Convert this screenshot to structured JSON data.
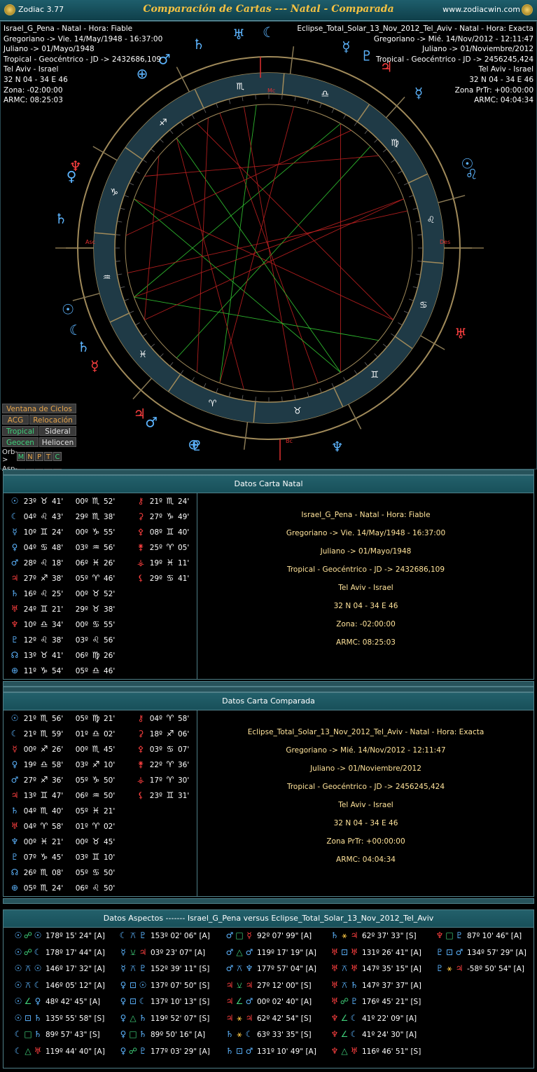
{
  "app": {
    "name": "Zodiac 3.77",
    "title": "Comparación de Cartas --- Natal - Comparada",
    "url": "www.zodiacwin.com"
  },
  "natal_header": [
    "Israel_G_Pena - Natal - Hora: Fiable",
    "Gregoriano -> Vie. 14/May/1948 - 16:37:00",
    "Juliano -> 01/Mayo/1948",
    "Tropical - Geocéntrico - JD -> 2432686,109",
    "Tel Aviv - Israel",
    "32 N 04 - 34 E 46",
    "Zona: -02:00:00",
    "ARMC: 08:25:03"
  ],
  "comp_header": [
    "Eclipse_Total_Solar_13_Nov_2012_Tel_Aviv - Natal - Hora: Exacta",
    "Gregoriano -> Mié. 14/Nov/2012 - 12:11:47",
    "Juliano -> 01/Noviembre/2012",
    "Tropical - Geocéntrico - JD -> 2456245,424",
    "Tel Aviv - Israel",
    "32 N 04 - 34 E 46",
    "Zona PrTr: +00:00:00",
    "ARMC: 04:04:34"
  ],
  "chart_labels": {
    "mc": "Mc",
    "asc": "Asc",
    "des": "Des",
    "bc": "Bc"
  },
  "buttons": {
    "ciclos": "Ventana de Ciclos",
    "acg": "ACG",
    "relocacion": "Relocación",
    "tropical": "Tropical",
    "sideral": "Sideral",
    "geocen": "Geocen",
    "heliocen": "Heliocen",
    "orb": "Orb->",
    "asp": "Asp->",
    "letters": [
      "M",
      "N",
      "P",
      "T",
      "C"
    ]
  },
  "natal_panel": {
    "title": "Datos Carta Natal",
    "rows": [
      {
        "p": "☉",
        "c": "#5db5ff",
        "d": "23º",
        "s": "♉",
        "m": "41'"
      },
      {
        "p": "☾",
        "c": "#5db5ff",
        "d": "04º",
        "s": "♌",
        "m": "43'"
      },
      {
        "p": "☿",
        "c": "#5db5ff",
        "d": "10º",
        "s": "♊",
        "m": "24'"
      },
      {
        "p": "♀",
        "c": "#5db5ff",
        "d": "04º",
        "s": "♋",
        "m": "48'"
      },
      {
        "p": "♂",
        "c": "#5db5ff",
        "d": "28º",
        "s": "♌",
        "m": "18'"
      },
      {
        "p": "♃",
        "c": "#ff4040",
        "d": "27º",
        "s": "♐",
        "m": "38'"
      },
      {
        "p": "♄",
        "c": "#5db5ff",
        "d": "16º",
        "s": "♌",
        "m": "25'"
      },
      {
        "p": "♅",
        "c": "#ff4040",
        "d": "24º",
        "s": "♊",
        "m": "21'"
      },
      {
        "p": "♆",
        "c": "#ff4040",
        "d": "10º",
        "s": "♎",
        "m": "34'"
      },
      {
        "p": "♇",
        "c": "#5db5ff",
        "d": "12º",
        "s": "♌",
        "m": "38'"
      },
      {
        "p": "☊",
        "c": "#5db5ff",
        "d": "13º",
        "s": "♉",
        "m": "41'"
      },
      {
        "p": "⊕",
        "c": "#5db5ff",
        "d": "11º",
        "s": "♑",
        "m": "54'"
      }
    ],
    "col2": [
      {
        "d": "00º",
        "s": "♏",
        "m": "52'"
      },
      {
        "d": "29º",
        "s": "♏",
        "m": "38'"
      },
      {
        "d": "00º",
        "s": "♑",
        "m": "55'"
      },
      {
        "d": "03º",
        "s": "♒",
        "m": "56'"
      },
      {
        "d": "06º",
        "s": "♓",
        "m": "26'"
      },
      {
        "d": "05º",
        "s": "♈",
        "m": "46'"
      },
      {
        "d": "00º",
        "s": "♉",
        "m": "52'"
      },
      {
        "d": "29º",
        "s": "♉",
        "m": "38'"
      },
      {
        "d": "00º",
        "s": "♋",
        "m": "55'"
      },
      {
        "d": "03º",
        "s": "♌",
        "m": "56'"
      },
      {
        "d": "06º",
        "s": "♍",
        "m": "26'"
      },
      {
        "d": "05º",
        "s": "♎",
        "m": "46'"
      }
    ],
    "col3": [
      {
        "p": "⚷",
        "c": "#ff4040",
        "d": "21º",
        "s": "♏",
        "m": "24'"
      },
      {
        "p": "⚳",
        "c": "#ff4040",
        "d": "27º",
        "s": "♑",
        "m": "49'"
      },
      {
        "p": "⚴",
        "c": "#ff4040",
        "d": "08º",
        "s": "♊",
        "m": "40'"
      },
      {
        "p": "⚵",
        "c": "#ff4040",
        "d": "25º",
        "s": "♈",
        "m": "05'"
      },
      {
        "p": "⚶",
        "c": "#ff4040",
        "d": "19º",
        "s": "♓",
        "m": "11'"
      },
      {
        "p": "⚸",
        "c": "#ff4040",
        "d": "29º",
        "s": "♋",
        "m": "41'"
      }
    ],
    "info": [
      "Israel_G_Pena - Natal - Hora: Fiable",
      "Gregoriano -> Vie. 14/May/1948 - 16:37:00",
      "Juliano -> 01/Mayo/1948",
      "Tropical - Geocéntrico - JD -> 2432686,109",
      "Tel Aviv - Israel",
      "32 N 04 - 34 E 46",
      "Zona: -02:00:00",
      "ARMC: 08:25:03"
    ]
  },
  "comp_panel": {
    "title": "Datos Carta Comparada",
    "rows": [
      {
        "p": "☉",
        "c": "#5db5ff",
        "d": "21º",
        "s": "♏",
        "m": "56'"
      },
      {
        "p": "☾",
        "c": "#5db5ff",
        "d": "21º",
        "s": "♏",
        "m": "59'"
      },
      {
        "p": "☿",
        "c": "#ff4040",
        "d": "00º",
        "s": "♐",
        "m": "26'"
      },
      {
        "p": "♀",
        "c": "#5db5ff",
        "d": "19º",
        "s": "♎",
        "m": "58'"
      },
      {
        "p": "♂",
        "c": "#5db5ff",
        "d": "27º",
        "s": "♐",
        "m": "36'"
      },
      {
        "p": "♃",
        "c": "#ff4040",
        "d": "13º",
        "s": "♊",
        "m": "47'"
      },
      {
        "p": "♄",
        "c": "#5db5ff",
        "d": "04º",
        "s": "♏",
        "m": "40'"
      },
      {
        "p": "♅",
        "c": "#ff4040",
        "d": "04º",
        "s": "♈",
        "m": "58'"
      },
      {
        "p": "♆",
        "c": "#5db5ff",
        "d": "00º",
        "s": "♓",
        "m": "21'"
      },
      {
        "p": "♇",
        "c": "#5db5ff",
        "d": "07º",
        "s": "♑",
        "m": "45'"
      },
      {
        "p": "☊",
        "c": "#5db5ff",
        "d": "26º",
        "s": "♏",
        "m": "08'"
      },
      {
        "p": "⊕",
        "c": "#5db5ff",
        "d": "05º",
        "s": "♏",
        "m": "24'"
      }
    ],
    "col2": [
      {
        "d": "05º",
        "s": "♍",
        "m": "21'"
      },
      {
        "d": "01º",
        "s": "♎",
        "m": "02'"
      },
      {
        "d": "00º",
        "s": "♏",
        "m": "45'"
      },
      {
        "d": "03º",
        "s": "♐",
        "m": "10'"
      },
      {
        "d": "05º",
        "s": "♑",
        "m": "50'"
      },
      {
        "d": "06º",
        "s": "♒",
        "m": "50'"
      },
      {
        "d": "05º",
        "s": "♓",
        "m": "21'"
      },
      {
        "d": "01º",
        "s": "♈",
        "m": "02'"
      },
      {
        "d": "00º",
        "s": "♉",
        "m": "45'"
      },
      {
        "d": "03º",
        "s": "♊",
        "m": "10'"
      },
      {
        "d": "05º",
        "s": "♋",
        "m": "50'"
      },
      {
        "d": "06º",
        "s": "♌",
        "m": "50'"
      }
    ],
    "col3": [
      {
        "p": "⚷",
        "c": "#ff4040",
        "d": "04º",
        "s": "♈",
        "m": "58'"
      },
      {
        "p": "⚳",
        "c": "#ff4040",
        "d": "18º",
        "s": "♐",
        "m": "06'"
      },
      {
        "p": "⚴",
        "c": "#ff4040",
        "d": "03º",
        "s": "♋",
        "m": "07'"
      },
      {
        "p": "⚵",
        "c": "#ff4040",
        "d": "22º",
        "s": "♈",
        "m": "36'"
      },
      {
        "p": "⚶",
        "c": "#ff4040",
        "d": "17º",
        "s": "♈",
        "m": "30'"
      },
      {
        "p": "⚸",
        "c": "#ff4040",
        "d": "23º",
        "s": "♊",
        "m": "31'"
      }
    ],
    "info": [
      "Eclipse_Total_Solar_13_Nov_2012_Tel_Aviv - Natal - Hora: Exacta",
      "Gregoriano -> Mié. 14/Nov/2012 - 12:11:47",
      "Juliano -> 01/Noviembre/2012",
      "Tropical - Geocéntrico - JD -> 2456245,424",
      "Tel Aviv - Israel",
      "32 N 04 - 34 E 46",
      "Zona PrTr: +00:00:00",
      "ARMC: 04:04:34"
    ]
  },
  "aspects_panel": {
    "title": "Datos Aspectos    -------    Israel_G_Pena    versus    Eclipse_Total_Solar_13_Nov_2012_Tel_Aviv",
    "columns": [
      [
        {
          "a": "☉",
          "ac": "#5db5ff",
          "x": "☍",
          "xc": "#3fd07a",
          "b": "☉",
          "bc": "#5db5ff",
          "v": "178º 15' 24\" [A]"
        },
        {
          "a": "☉",
          "ac": "#5db5ff",
          "x": "☍",
          "xc": "#3fd07a",
          "b": "☾",
          "bc": "#5db5ff",
          "v": "178º 17' 44\" [A]"
        },
        {
          "a": "☉",
          "ac": "#5db5ff",
          "x": "⚻",
          "xc": "#5db5ff",
          "b": "☉",
          "bc": "#5db5ff",
          "v": "146º 17' 32\" [A]"
        },
        {
          "a": "☉",
          "ac": "#5db5ff",
          "x": "⚻",
          "xc": "#5db5ff",
          "b": "☾",
          "bc": "#5db5ff",
          "v": "146º 05' 12\" [A]"
        },
        {
          "a": "☉",
          "ac": "#5db5ff",
          "x": "∠",
          "xc": "#3fd07a",
          "b": "♀",
          "bc": "#5db5ff",
          "v": "48º 42' 45\" [A]"
        },
        {
          "a": "☉",
          "ac": "#5db5ff",
          "x": "⊡",
          "xc": "#5db5ff",
          "b": "♄",
          "bc": "#5db5ff",
          "v": "135º 55' 58\" [S]"
        },
        {
          "a": "☾",
          "ac": "#5db5ff",
          "x": "□",
          "xc": "#3fd07a",
          "b": "♄",
          "bc": "#5db5ff",
          "v": "89º 57' 43\" [S]"
        },
        {
          "a": "☾",
          "ac": "#5db5ff",
          "x": "△",
          "xc": "#3fd07a",
          "b": "♅",
          "bc": "#ff4040",
          "v": "119º 44' 40\" [A]"
        }
      ],
      [
        {
          "a": "☾",
          "ac": "#5db5ff",
          "x": "⚻",
          "xc": "#5db5ff",
          "b": "♇",
          "bc": "#5db5ff",
          "v": "153º 02' 06\" [A]"
        },
        {
          "a": "☿",
          "ac": "#5db5ff",
          "x": "⚺",
          "xc": "#3fd07a",
          "b": "♃",
          "bc": "#ff4040",
          "v": "03º 23' 07\" [A]"
        },
        {
          "a": "☿",
          "ac": "#5db5ff",
          "x": "⚻",
          "xc": "#5db5ff",
          "b": "♇",
          "bc": "#5db5ff",
          "v": "152º 39' 11\" [S]"
        },
        {
          "a": "♀",
          "ac": "#5db5ff",
          "x": "⊡",
          "xc": "#5db5ff",
          "b": "☉",
          "bc": "#5db5ff",
          "v": "137º 07' 50\" [S]"
        },
        {
          "a": "♀",
          "ac": "#5db5ff",
          "x": "⊡",
          "xc": "#5db5ff",
          "b": "☾",
          "bc": "#5db5ff",
          "v": "137º 10' 13\" [S]"
        },
        {
          "a": "♀",
          "ac": "#5db5ff",
          "x": "△",
          "xc": "#3fd07a",
          "b": "♄",
          "bc": "#5db5ff",
          "v": "119º 52' 07\" [S]"
        },
        {
          "a": "♀",
          "ac": "#5db5ff",
          "x": "□",
          "xc": "#3fd07a",
          "b": "♄",
          "bc": "#5db5ff",
          "v": "89º 50' 16\" [A]"
        },
        {
          "a": "♀",
          "ac": "#5db5ff",
          "x": "☍",
          "xc": "#3fd07a",
          "b": "♇",
          "bc": "#5db5ff",
          "v": "177º 03' 29\" [A]"
        }
      ],
      [
        {
          "a": "♂",
          "ac": "#5db5ff",
          "x": "□",
          "xc": "#3fd07a",
          "b": "☿",
          "bc": "#ff4040",
          "v": "92º 07' 99\" [A]"
        },
        {
          "a": "♂",
          "ac": "#5db5ff",
          "x": "△",
          "xc": "#3fd07a",
          "b": "♂",
          "bc": "#5db5ff",
          "v": "119º 17' 19\" [A]"
        },
        {
          "a": "♂",
          "ac": "#5db5ff",
          "x": "⚻",
          "xc": "#5db5ff",
          "b": "♆",
          "bc": "#5db5ff",
          "v": "177º 57' 04\" [A]"
        },
        {
          "a": "♃",
          "ac": "#ff4040",
          "x": "⚺",
          "xc": "#3fd07a",
          "b": "♃",
          "bc": "#ff4040",
          "v": "27º 12' 00\" [S]"
        },
        {
          "a": "♃",
          "ac": "#ff4040",
          "x": "∠",
          "xc": "#3fd07a",
          "b": "♂",
          "bc": "#5db5ff",
          "v": "00º 02' 40\" [A]"
        },
        {
          "a": "♃",
          "ac": "#ff4040",
          "x": "⚹",
          "xc": "#f5c242",
          "b": "♃",
          "bc": "#ff4040",
          "v": "62º 42' 54\" [S]"
        },
        {
          "a": "♄",
          "ac": "#5db5ff",
          "x": "⚹",
          "xc": "#f5c242",
          "b": "☾",
          "bc": "#5db5ff",
          "v": "63º 33' 35\" [S]"
        },
        {
          "a": "♄",
          "ac": "#5db5ff",
          "x": "⊡",
          "xc": "#5db5ff",
          "b": "♂",
          "bc": "#5db5ff",
          "v": "131º 10' 49\" [A]"
        }
      ],
      [
        {
          "a": "♄",
          "ac": "#5db5ff",
          "x": "⚹",
          "xc": "#f5c242",
          "b": "♃",
          "bc": "#ff4040",
          "v": "62º 37' 33\" [S]"
        },
        {
          "a": "♅",
          "ac": "#ff4040",
          "x": "⊡",
          "xc": "#5db5ff",
          "b": "♅",
          "bc": "#ff4040",
          "v": "131º 26' 41\" [A]"
        },
        {
          "a": "♅",
          "ac": "#ff4040",
          "x": "⚻",
          "xc": "#5db5ff",
          "b": "♅",
          "bc": "#ff4040",
          "v": "147º 35' 15\" [A]"
        },
        {
          "a": "♅",
          "ac": "#ff4040",
          "x": "⚻",
          "xc": "#5db5ff",
          "b": "♄",
          "bc": "#5db5ff",
          "v": "147º 37' 37\" [A]"
        },
        {
          "a": "♅",
          "ac": "#ff4040",
          "x": "☍",
          "xc": "#3fd07a",
          "b": "♇",
          "bc": "#5db5ff",
          "v": "176º 45' 21\" [S]"
        },
        {
          "a": "♆",
          "ac": "#ff4040",
          "x": "∠",
          "xc": "#3fd07a",
          "b": "☾",
          "bc": "#5db5ff",
          "v": "41º 22' 09\" [A]"
        },
        {
          "a": "♆",
          "ac": "#ff4040",
          "x": "∠",
          "xc": "#3fd07a",
          "b": "☾",
          "bc": "#5db5ff",
          "v": "41º 24' 30\" [A]"
        },
        {
          "a": "♆",
          "ac": "#ff4040",
          "x": "△",
          "xc": "#3fd07a",
          "b": "♅",
          "bc": "#ff4040",
          "v": "116º 46' 51\" [S]"
        }
      ],
      [
        {
          "a": "♆",
          "ac": "#ff4040",
          "x": "□",
          "xc": "#3fd07a",
          "b": "♇",
          "bc": "#5db5ff",
          "v": "87º 10' 46\" [A]"
        },
        {
          "a": "♇",
          "ac": "#5db5ff",
          "x": "⊡",
          "xc": "#5db5ff",
          "b": "♂",
          "bc": "#5db5ff",
          "v": "134º 57' 29\" [A]"
        },
        {
          "a": "♇",
          "ac": "#5db5ff",
          "x": "⚹",
          "xc": "#f5c242",
          "b": "♃",
          "bc": "#ff4040",
          "v": "-58º 50' 54\" [A]"
        }
      ]
    ]
  }
}
